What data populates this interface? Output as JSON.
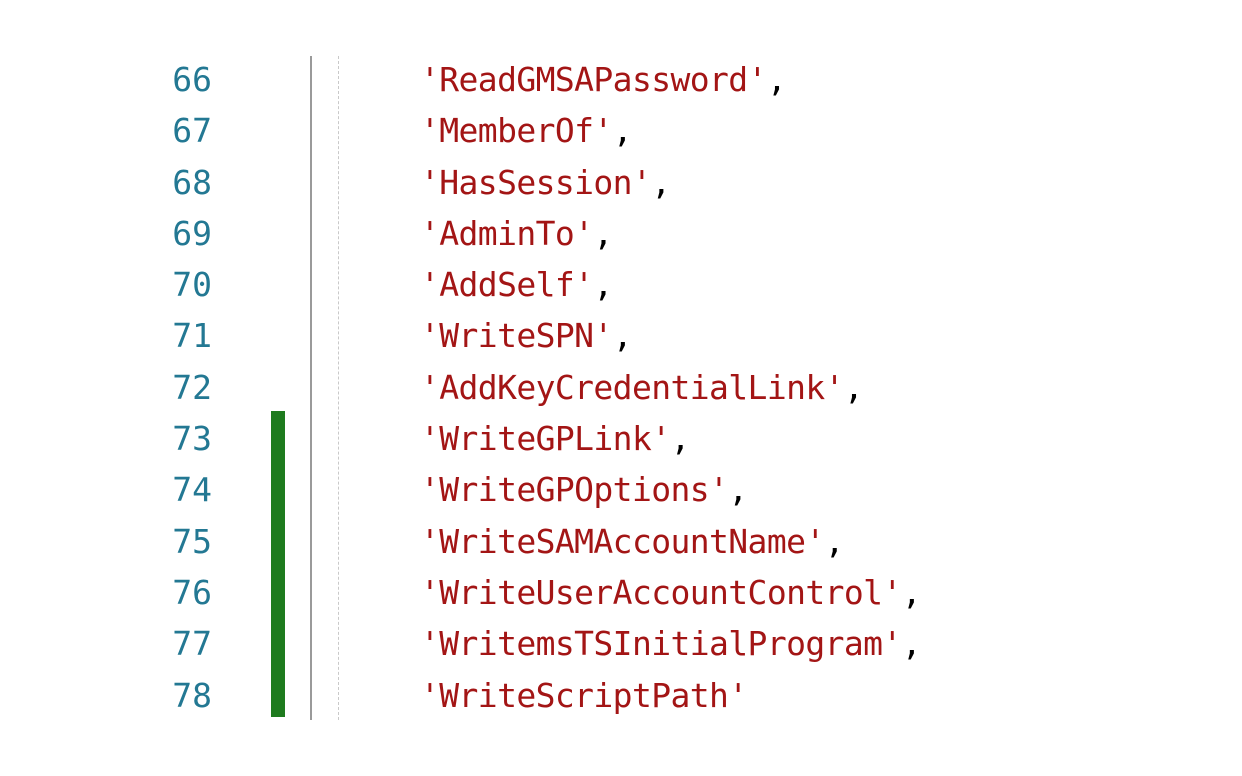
{
  "editor": {
    "lines": [
      {
        "number": "66",
        "string": "'ReadGMSAPassword'",
        "punct": ","
      },
      {
        "number": "67",
        "string": "'MemberOf'",
        "punct": ","
      },
      {
        "number": "68",
        "string": "'HasSession'",
        "punct": ","
      },
      {
        "number": "69",
        "string": "'AdminTo'",
        "punct": ","
      },
      {
        "number": "70",
        "string": "'AddSelf'",
        "punct": ","
      },
      {
        "number": "71",
        "string": "'WriteSPN'",
        "punct": ","
      },
      {
        "number": "72",
        "string": "'AddKeyCredentialLink'",
        "punct": ","
      },
      {
        "number": "73",
        "string": "'WriteGPLink'",
        "punct": ","
      },
      {
        "number": "74",
        "string": "'WriteGPOptions'",
        "punct": ","
      },
      {
        "number": "75",
        "string": "'WriteSAMAccountName'",
        "punct": ","
      },
      {
        "number": "76",
        "string": "'WriteUserAccountControl'",
        "punct": ","
      },
      {
        "number": "77",
        "string": "'WritemsTSInitialProgram'",
        "punct": ","
      },
      {
        "number": "78",
        "string": "'WriteScriptPath'",
        "punct": ""
      }
    ],
    "diff": {
      "added_from_line": "73",
      "added_to_line": "78",
      "color": "#1e7b1e"
    },
    "colors": {
      "line_number": "#237893",
      "string": "#a31515",
      "punctuation": "#000000",
      "background": "#ffffff"
    }
  }
}
